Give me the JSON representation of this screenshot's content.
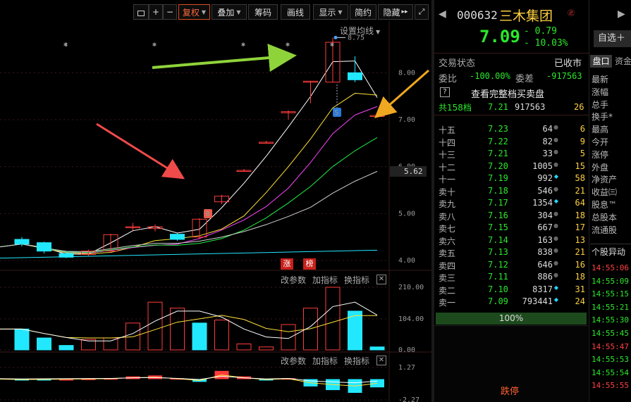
{
  "toolbar": {
    "lock_label": "",
    "plus_label": "+",
    "minus_label": "−",
    "fuquan_label": "复权",
    "diejia_label": "叠加",
    "chouma_label": "筹码",
    "huaxian_label": "画线",
    "xianshi_label": "显示",
    "jianyue_label": "简约",
    "yincang_label": "隐藏",
    "collapse_label": "▸▸"
  },
  "chart": {
    "ma_setting": "设置均线",
    "high_marker": "8.75",
    "current_price_tag": "5.62",
    "price_axis": [
      "8.00",
      "7.00",
      "6.00",
      "5.00",
      "4.00"
    ],
    "zhang_label": "涨",
    "bang_label": "榜",
    "buy_marker": "B",
    "sell_marker": "S",
    "vol_axis": [
      "210.00",
      "104.00",
      "0.00"
    ],
    "ind_axis": [
      "1.27",
      "-2.27"
    ],
    "vol_panel": {
      "gaicanshu": "改参数",
      "jiazhibiao": "加指标",
      "huanzhibiao": "换指标",
      "close": "✕"
    },
    "ind_panel": {
      "gaicanshu": "改参数",
      "jiazhibiao": "加指标",
      "huanzhibiao": "换指标",
      "close": "✕"
    },
    "colors": {
      "up": "#ff3c3c",
      "down": "#22e8ff",
      "ma5": "#ffffff",
      "ma10": "#ffe23a",
      "ma20": "#ff44ff",
      "ma30": "#22ee44",
      "ma60": "#d0d0d0",
      "grid": "#3a1a1a"
    }
  },
  "chart_data": {
    "type": "candlestick",
    "price_ylim": [
      3.85,
      8.95
    ],
    "candles": [
      {
        "o": 4.45,
        "c": 4.35,
        "h": 4.5,
        "l": 4.3
      },
      {
        "o": 4.38,
        "c": 4.2,
        "h": 4.4,
        "l": 4.15
      },
      {
        "o": 4.15,
        "c": 4.07,
        "h": 4.18,
        "l": 4.05
      },
      {
        "o": 4.13,
        "c": 4.2,
        "h": 4.23,
        "l": 4.1
      },
      {
        "o": 4.2,
        "c": 4.55,
        "h": 4.57,
        "l": 4.18
      },
      {
        "o": 4.7,
        "c": 4.72,
        "h": 4.8,
        "l": 4.64
      },
      {
        "o": 4.68,
        "c": 4.72,
        "h": 4.77,
        "l": 4.62
      },
      {
        "o": 4.56,
        "c": 4.45,
        "h": 4.58,
        "l": 4.42
      },
      {
        "o": 4.5,
        "c": 4.88,
        "h": 4.9,
        "l": 4.45
      },
      {
        "o": 5.25,
        "c": 5.37,
        "h": 5.4,
        "l": 5.2
      },
      {
        "o": 5.9,
        "c": 5.92,
        "h": 5.95,
        "l": 5.9
      },
      {
        "o": 6.5,
        "c": 6.52,
        "h": 6.55,
        "l": 6.5
      },
      {
        "o": 7.15,
        "c": 7.17,
        "h": 7.2,
        "l": 7.0
      },
      {
        "o": 7.8,
        "c": 7.82,
        "h": 7.82,
        "l": 7.35
      },
      {
        "o": 7.8,
        "c": 8.65,
        "h": 8.75,
        "l": 7.8
      },
      {
        "o": 8.0,
        "c": 7.85,
        "h": 8.35,
        "l": 7.8
      },
      {
        "o": 7.09,
        "c": 7.09,
        "h": 7.1,
        "l": 7.08
      }
    ],
    "volume": {
      "ylim": [
        0,
        210
      ],
      "values": [
        70,
        40,
        15,
        35,
        40,
        90,
        160,
        140,
        90,
        100,
        20,
        10,
        85,
        140,
        210,
        130,
        10
      ],
      "up": [
        false,
        false,
        false,
        true,
        true,
        true,
        true,
        true,
        false,
        true,
        true,
        true,
        true,
        true,
        true,
        false,
        false
      ]
    },
    "indicator": {
      "ylim": [
        -2.27,
        1.27
      ],
      "values": [
        -0.1,
        -0.05,
        0,
        0.05,
        0.1,
        0.3,
        0.4,
        0.1,
        -0.3,
        0.9,
        0.3,
        -0.1,
        0.1,
        -0.8,
        -1.2,
        -1.5,
        -0.9
      ]
    }
  },
  "quote": {
    "code": "000632",
    "name": "三木集团",
    "badge": "㉣",
    "price": "7.09",
    "change": "- 0.79",
    "change_pct": "- 10.03%",
    "zixuan_label": "自选＋",
    "status_label": "交易状态",
    "status_value": "已收市",
    "weibi_label": "委比",
    "weibi_value": "-100.00%",
    "weicha_label": "委差",
    "weicha_value": "-917563",
    "help_icon": "?",
    "view_full_label": "查看完整档买卖盘",
    "total_label": "共158档",
    "total_price": "7.21",
    "total_vol": "917563",
    "total_cnt": "26",
    "summary_pct": "100%",
    "dieting_label": "跌停"
  },
  "orderbook": [
    {
      "label": "十五",
      "price": "7.23",
      "vol": "64",
      "cyan": false,
      "cnt": "6"
    },
    {
      "label": "十四",
      "price": "7.22",
      "vol": "82",
      "cyan": false,
      "cnt": "9"
    },
    {
      "label": "十三",
      "price": "7.21",
      "vol": "33",
      "cyan": false,
      "cnt": "5"
    },
    {
      "label": "十二",
      "price": "7.20",
      "vol": "1005",
      "cyan": false,
      "cnt": "15"
    },
    {
      "label": "十一",
      "price": "7.19",
      "vol": "992",
      "cyan": true,
      "cnt": "58"
    },
    {
      "label": "卖十",
      "price": "7.18",
      "vol": "546",
      "cyan": false,
      "cnt": "21"
    },
    {
      "label": "卖九",
      "price": "7.17",
      "vol": "1354",
      "cyan": true,
      "cnt": "64"
    },
    {
      "label": "卖八",
      "price": "7.16",
      "vol": "304",
      "cyan": false,
      "cnt": "18"
    },
    {
      "label": "卖七",
      "price": "7.15",
      "vol": "667",
      "cyan": false,
      "cnt": "17"
    },
    {
      "label": "卖六",
      "price": "7.14",
      "vol": "163",
      "cyan": false,
      "cnt": "13"
    },
    {
      "label": "卖五",
      "price": "7.13",
      "vol": "838",
      "cyan": false,
      "cnt": "21"
    },
    {
      "label": "卖四",
      "price": "7.12",
      "vol": "646",
      "cyan": false,
      "cnt": "16"
    },
    {
      "label": "卖三",
      "price": "7.11",
      "vol": "886",
      "cyan": false,
      "cnt": "18"
    },
    {
      "label": "卖二",
      "price": "7.10",
      "vol": "8317",
      "cyan": true,
      "cnt": "31"
    },
    {
      "label": "卖一",
      "price": "7.09",
      "vol": "793441",
      "cyan": true,
      "cnt": "24"
    }
  ],
  "side": {
    "tab_pankou": "盘口",
    "tab_zijin": "资金",
    "labels": [
      "最新",
      "涨幅",
      "总手",
      "换手*",
      "最高",
      "今开",
      "涨停",
      "外盘",
      "净资产",
      "收益㈢",
      "股息™",
      "总股本",
      "流通股"
    ],
    "ticks_header": "个股异动",
    "ticks": [
      {
        "t": "14:55:06",
        "up": true
      },
      {
        "t": "14:55:09",
        "up": false
      },
      {
        "t": "14:55:15",
        "up": false
      },
      {
        "t": "14:55:21",
        "up": false
      },
      {
        "t": "14:55:30",
        "up": false
      },
      {
        "t": "14:55:45",
        "up": false
      },
      {
        "t": "14:55:47",
        "up": true
      },
      {
        "t": "14:55:53",
        "up": false
      },
      {
        "t": "14:55:54",
        "up": false
      },
      {
        "t": "14:55:55",
        "up": true
      }
    ]
  }
}
